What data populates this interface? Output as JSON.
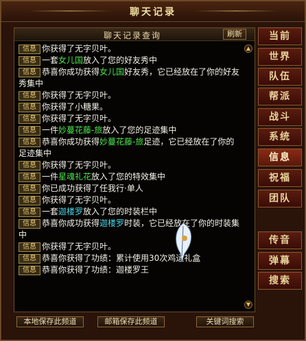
{
  "window": {
    "title": "聊天记录"
  },
  "panel": {
    "title": "聊天记录查询",
    "refresh_label": "刷新"
  },
  "tag_label": "信息",
  "log": [
    {
      "parts": [
        {
          "t": "你获得了无字贝叶。"
        }
      ]
    },
    {
      "parts": [
        {
          "t": "一套"
        },
        {
          "t": "女儿国",
          "c": "g"
        },
        {
          "t": "放入了您的好友秀中"
        }
      ]
    },
    {
      "parts": [
        {
          "t": "恭喜你成功获得"
        },
        {
          "t": "女儿国",
          "c": "g"
        },
        {
          "t": "好友秀，它已经放在了你的好友秀集中"
        }
      ]
    },
    {
      "parts": [
        {
          "t": "你获得了无字贝叶。"
        }
      ]
    },
    {
      "parts": [
        {
          "t": "你获得了小糖果。"
        }
      ]
    },
    {
      "parts": [
        {
          "t": "你获得了无字贝叶。"
        }
      ]
    },
    {
      "parts": [
        {
          "t": "一件"
        },
        {
          "t": "妙蔓花藤-旅",
          "c": "g"
        },
        {
          "t": "放入了您的足迹集中"
        }
      ]
    },
    {
      "parts": [
        {
          "t": "恭喜你成功获得"
        },
        {
          "t": "妙蔓花藤-旅",
          "c": "g"
        },
        {
          "t": "足迹，它已经放在了你的足迹集中"
        }
      ]
    },
    {
      "parts": [
        {
          "t": "你获得了无字贝叶。"
        }
      ]
    },
    {
      "parts": [
        {
          "t": "一件"
        },
        {
          "t": "星魂礼花",
          "c": "g"
        },
        {
          "t": "放入了您的特效集中"
        }
      ]
    },
    {
      "parts": [
        {
          "t": "你已成功获得了任我行·单人"
        }
      ]
    },
    {
      "parts": [
        {
          "t": "你获得了无字贝叶。"
        }
      ]
    },
    {
      "parts": [
        {
          "t": "一套"
        },
        {
          "t": "迦楼罗",
          "c": "c"
        },
        {
          "t": "放入了您的时装栏中"
        }
      ]
    },
    {
      "parts": [
        {
          "t": "恭喜你成功获得"
        },
        {
          "t": "迦楼罗",
          "c": "c"
        },
        {
          "t": "时装，它已经放在了你的时装集中"
        }
      ]
    },
    {
      "parts": [
        {
          "t": "你获得了无字贝叶。"
        }
      ]
    },
    {
      "parts": [
        {
          "t": "恭喜你获得了功绩：累计使用30次鸡运礼盒"
        }
      ]
    },
    {
      "parts": [
        {
          "t": "恭喜你获得了功绩：迦楼罗王"
        }
      ]
    }
  ],
  "tabs": [
    "当前",
    "世界",
    "队伍",
    "帮派",
    "战斗",
    "系统",
    "信息",
    "祝福",
    "团队",
    "传音",
    "弹幕",
    "搜索"
  ],
  "active_tab": "信息",
  "buttons": {
    "save_local": "本地保存此频道",
    "mail_save": "邮箱保存此频道",
    "keyword_search": "关键词搜索"
  },
  "colors": {
    "green": "#4ce04c",
    "cyan": "#4ad6e8",
    "tag_gold": "#e8c878"
  }
}
